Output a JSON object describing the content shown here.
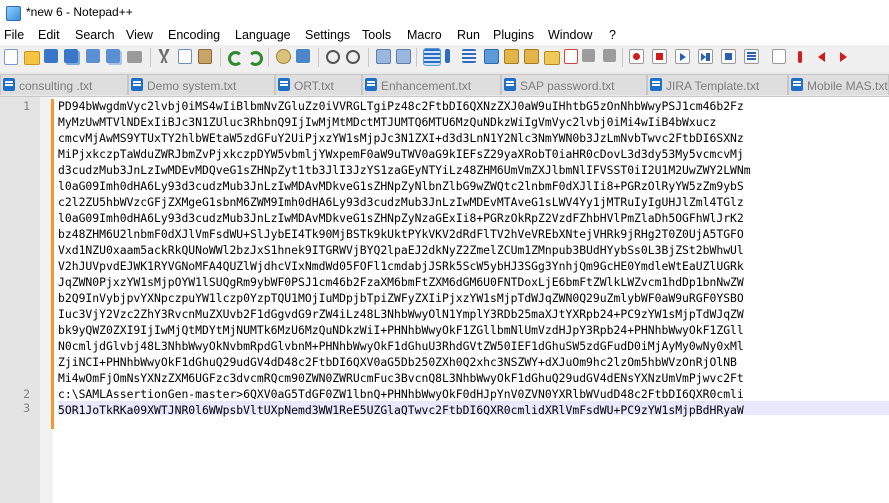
{
  "window": {
    "title": "*new 6 - Notepad++"
  },
  "menu": [
    "File",
    "Edit",
    "Search",
    "View",
    "Encoding",
    "Language",
    "Settings",
    "Tools",
    "Macro",
    "Run",
    "Plugins",
    "Window",
    "?"
  ],
  "toolbar": {
    "icons": [
      "new-file-icon",
      "open-file-icon",
      "save-icon",
      "save-all-icon",
      "close-icon",
      "close-all-icon",
      "print-icon",
      "cut-icon",
      "copy-icon",
      "paste-icon",
      "undo-icon",
      "redo-icon",
      "find-icon",
      "replace-icon",
      "zoom-in-icon",
      "zoom-out-icon",
      "sync-vertical-icon",
      "sync-horizontal-icon",
      "word-wrap-icon",
      "show-all-chars-icon",
      "indent-guide-icon",
      "user-lang-icon",
      "doc-map-icon",
      "function-list-icon",
      "folder-workspace-icon",
      "doc-monitor-icon",
      "record-macro-icon",
      "stop-record-icon",
      "play-macro-icon",
      "run-macro-multiple-icon",
      "save-macro-icon",
      "extra-red-icon",
      "prev-icon",
      "next-icon"
    ],
    "colors": {
      "accent": "#1e6fc8",
      "record": "#d01c1c"
    }
  },
  "tabs": [
    {
      "label": "consulting .txt"
    },
    {
      "label": "Demo system.txt"
    },
    {
      "label": "ORT.txt"
    },
    {
      "label": "Enhancement.txt"
    },
    {
      "label": "SAP password.txt"
    },
    {
      "label": "JIRA Template.txt"
    },
    {
      "label": "Mobile MAS.txt"
    }
  ],
  "editor": {
    "line_numbers": [
      "1",
      "2",
      "3"
    ],
    "lines": [
      "PD94bWwgdmVyc2lvbj0iMS4wIiBlbmNvZGluZz0iVVRGLTgiPz48c2FtbDI6QXNzZXJ0aW9uIHhtbG5zOnNhbWwyPSJ1cm46b2Fz",
      "MyMzUwMTVlNDExIiBJc3N1ZUluc3RhbnQ9IjIwMjMtMDctMTJUMTQ6MTU6MzQuNDkzWiIgVmVyc2lvbj0iMi4wIiB4bWxucz",
      "cmcvMjAwMS9YTUxTY2hlbWEtaW5zdGFuY2UiPjxzYW1sMjpJc3N1ZXI+d3d3LnN1Y2Nlc3NmYWN0b3JzLmNvbTwvc2FtbDI6SXNz",
      "MiPjxkczpTaWduZWRJbmZvPjxkczpDYW5vbmljYWxpemF0aW9uTWV0aG9kIEFsZ29yaXRobT0iaHR0cDovL3d3dy53My5vcmcvMj",
      "d3cudzMub3JnLzIwMDEvMDQveG1sZHNpZyt1tb3JlI3JzYS1zaGEyNTYiLz48ZHM6UmVmZXJlbmNlIFVSST0iI2U1M2UwZWY2LWNm",
      "l0aG09Imh0dHA6Ly93d3cudzMub3JnLzIwMDAvMDkveG1sZHNpZyNlbnZlbG9wZWQtc2lnbmF0dXJlIi8+PGRzOlRyYW5zZm9ybS",
      "c2l2ZU5hbWVzcGFjZXMgeG1sbnM6ZWM9Imh0dHA6Ly93d3cudzMub3JnLzIwMDEvMTAveG1sLWV4Yy1jMTRuIyIgUHJlZml4TGlz",
      "l0aG09Imh0dHA6Ly93d3cudzMub3JnLzIwMDAvMDkveG1sZHNpZyNzaGExIi8+PGRzOkRpZ2VzdFZhbHVlPmZlaDh5OGFhWlJrK2",
      "bz48ZHM6U2lnbmF0dXJlVmFsdWU+SlJybEI4Tk90MjBSTk9kUktPYkVKV2dRdFlTV2hVeVREbXNtejVHRk9jRHg2T0Z0UjA5TGFO",
      "Vxd1NZU0xaam5ackRkQUNoWWl2bzJxS1hnek9ITGRWVjBYQ2lpaEJ2dkNyZ2ZmelZCUm1ZMnpub3BUdHYybSs0L3BjZSt2bWhwUl",
      "V2hJUVpvdEJWK1RYVGNoMFA4QUZlWjdhcVIxNmdWd05FOFl1cmdabjJSRk5ScW5ybHJ3SGg3YnhjQm9GcHE0YmdleWtEaUZlUGRk",
      "JqZWN0PjxzYW1sMjpOYW1lSUQgRm9ybWF0PSJ1cm46b2FzaXM6bmFtZXM6dGM6U0FNTDoxLjE6bmFtZWlkLWZvcm1hdDp1bnNwZW",
      "b2Q9InVybjpvYXNpczpuYW1lczp0YzpTQU1MOjIuMDpjbTpiZWFyZXIiPjxzYW1sMjpTdWJqZWN0Q29uZmlybWF0aW9uRGF0YSBO",
      "Iuc3VjY2Vzc2ZhY3RvcnMuZXUvb2F1dGgvdG9rZW4iLz48L3NhbWwyOlN1YmplY3RDb25maXJtYXRpb24+PC9zYW1sMjpTdWJqZW",
      "bk9yQWZ0ZXI9IjIwMjQtMDYtMjNUMTk6MzU6MzQuNDkzWiI+PHNhbWwyOkF1ZGllbmNlUmVzdHJpY3Rpb24+PHNhbWwyOkF1ZGll",
      "N0cmljdGlvbj48L3NhbWwyOkNvbmRpdGlvbnM+PHNhbWwyOkF1dGhuU3RhdGVtZW50IEF1dGhuSW5zdGFudD0iMjAyMy0wNy0xMl",
      "ZjiNCI+PHNhbWwyOkF1dGhuQ29udGV4dD48c2FtbDI6QXV0aG5Db250ZXh0Q2xhc3NSZWY+dXJuOm9hc2lzOm5hbWVzOnRjOlNB",
      "Mi4wOmFjOmNsYXNzZXM6UGFzc3dvcmRQcm90ZWN0ZWRUcmFuc3BvcnQ8L3NhbWwyOkF1dGhuQ29udGV4dENsYXNzUmVmPjwvc2Ft",
      "c:\\SAMLAssertionGen-master>6QXV0aG5TdGF0ZW1lbnQ+PHNhbWwyOkF0dHJpYnV0ZVN0YXRlbWVudD48c2FtbDI6QXR0cmli",
      "5OR1JoTkRKa09XWTJNR0l6WWpsbVltUXpNemd3WW1ReE5UZGlaQTwvc2FtbDI6QXR0cmlidXRlVmFsdWU+PC9zYW1sMjpBdHRyaW"
    ],
    "highlighted_line_index": 18
  }
}
